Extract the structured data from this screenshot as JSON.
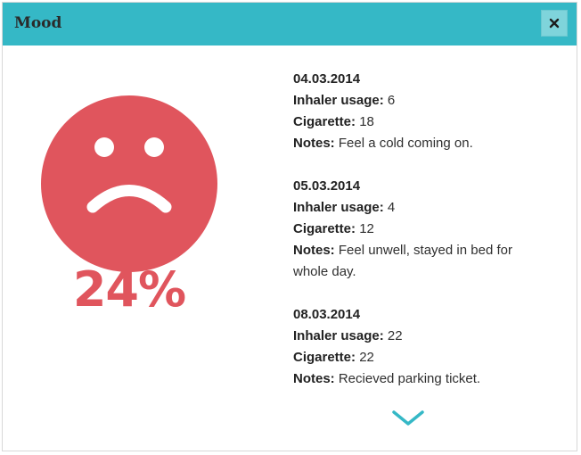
{
  "dialog": {
    "title": "Mood",
    "close_label": "×",
    "mood_percent": "24%",
    "accent_color": "#35b8c6",
    "mood_color": "#e0555d",
    "face_icon": "sad-face-icon"
  },
  "entries": [
    {
      "date": "04.03.2014",
      "inhaler_label": "Inhaler usage:",
      "inhaler": "6",
      "cigarette_label": "Cigarette:",
      "cigarette": "18",
      "notes_label": "Notes:",
      "notes": "Feel a cold coming on."
    },
    {
      "date": "05.03.2014",
      "inhaler_label": "Inhaler usage:",
      "inhaler": "4",
      "cigarette_label": "Cigarette:",
      "cigarette": "12",
      "notes_label": "Notes:",
      "notes": "Feel unwell, stayed in bed for whole day."
    },
    {
      "date": "08.03.2014",
      "inhaler_label": "Inhaler usage:",
      "inhaler": "22",
      "cigarette_label": "Cigarette:",
      "cigarette": "22",
      "notes_label": "Notes:",
      "notes": "Recieved parking ticket."
    }
  ]
}
